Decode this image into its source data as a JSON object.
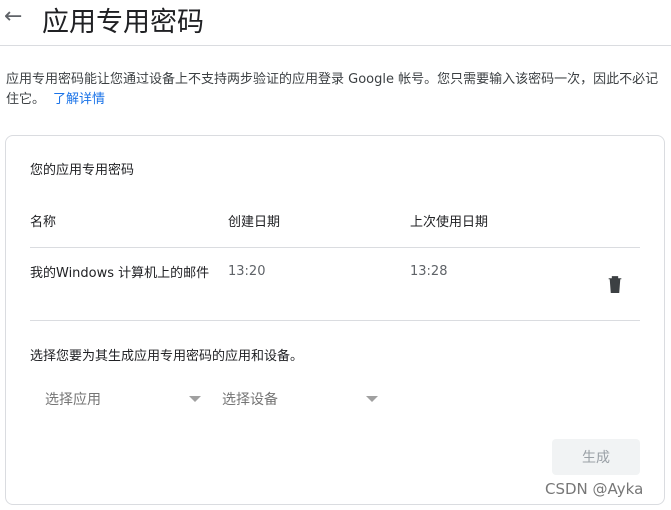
{
  "header": {
    "title": "应用专用密码"
  },
  "description": {
    "text": "应用专用密码能让您通过设备上不支持两步验证的应用登录 Google 帐号。您只需要输入该密码一次，因此不必记住它。",
    "link": "了解详情"
  },
  "card": {
    "heading": "您的应用专用密码",
    "columns": [
      "名称",
      "创建日期",
      "上次使用日期"
    ],
    "rows": [
      {
        "name": "我的Windows 计算机上的邮件",
        "created": "13:20",
        "last_used": "13:28"
      }
    ],
    "generate_prompt": "选择您要为其生成应用专用密码的应用和设备。",
    "select_app": "选择应用",
    "select_device": "选择设备",
    "generate_label": "生成"
  },
  "watermark": "CSDN @Ayka"
}
